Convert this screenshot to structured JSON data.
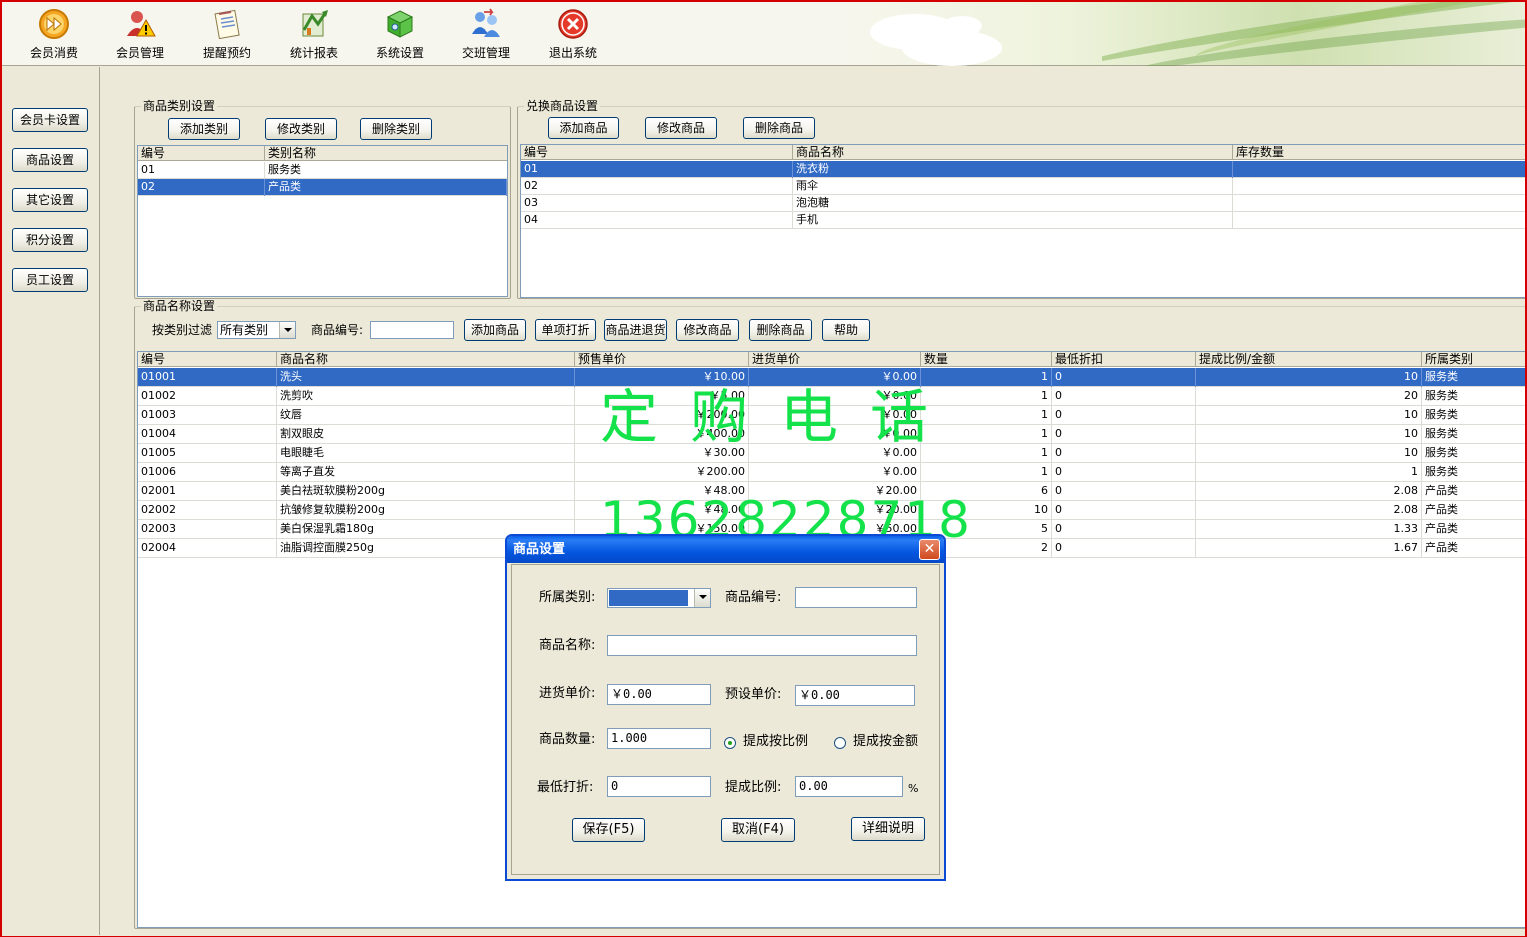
{
  "toolbar": {
    "items": [
      {
        "label": "会员消费",
        "icon": "fast-forward-icon"
      },
      {
        "label": "会员管理",
        "icon": "warning-user-icon"
      },
      {
        "label": "提醒预约",
        "icon": "notepad-icon"
      },
      {
        "label": "统计报表",
        "icon": "chart-report-icon"
      },
      {
        "label": "系统设置",
        "icon": "cube-settings-icon"
      },
      {
        "label": "交班管理",
        "icon": "shift-transfer-icon"
      },
      {
        "label": "退出系统",
        "icon": "exit-icon"
      }
    ]
  },
  "sidebar": {
    "items": [
      "会员卡设置",
      "商品设置",
      "其它设置",
      "积分设置",
      "员工设置"
    ]
  },
  "category_group": {
    "title": "商品类别设置",
    "buttons": [
      "添加类别",
      "修改类别",
      "删除类别"
    ],
    "columns": [
      "编号",
      "类别名称"
    ],
    "rows": [
      [
        "01",
        "服务类"
      ],
      [
        "02",
        "产品类"
      ]
    ],
    "selected_row": 1
  },
  "exchange_group": {
    "title": "兑换商品设置",
    "buttons": [
      "添加商品",
      "修改商品",
      "删除商品"
    ],
    "columns": [
      "编号",
      "商品名称",
      "库存数量"
    ],
    "rows": [
      [
        "01",
        "洗衣粉",
        ""
      ],
      [
        "02",
        "雨伞",
        ""
      ],
      [
        "03",
        "泡泡糖",
        ""
      ],
      [
        "04",
        "手机",
        ""
      ]
    ],
    "selected_row": 0
  },
  "product_group": {
    "title": "商品名称设置",
    "filter_label": "按类别过滤",
    "filter_value": "所有类别",
    "code_label": "商品编号:",
    "code_value": "",
    "buttons": [
      "添加商品",
      "单项打折",
      "商品进退货",
      "修改商品",
      "删除商品",
      "帮助"
    ],
    "columns": [
      "编号",
      "商品名称",
      "预售单价",
      "进货单价",
      "数量",
      "最低折扣",
      "提成比例/金额",
      "所属类别"
    ],
    "rows": [
      [
        "01001",
        "洗头",
        "￥10.00",
        "￥0.00",
        "1",
        "0",
        "10",
        "服务类"
      ],
      [
        "01002",
        "洗剪吹",
        "￥5.00",
        "￥0.00",
        "1",
        "0",
        "20",
        "服务类"
      ],
      [
        "01003",
        "纹唇",
        "￥200.00",
        "￥0.00",
        "1",
        "0",
        "10",
        "服务类"
      ],
      [
        "01004",
        "割双眼皮",
        "￥400.00",
        "￥0.00",
        "1",
        "0",
        "10",
        "服务类"
      ],
      [
        "01005",
        "电眼睫毛",
        "￥30.00",
        "￥0.00",
        "1",
        "0",
        "10",
        "服务类"
      ],
      [
        "01006",
        "等离子直发",
        "￥200.00",
        "￥0.00",
        "1",
        "0",
        "1",
        "服务类"
      ],
      [
        "02001",
        "美白祛斑软膜粉200g",
        "￥48.00",
        "￥20.00",
        "6",
        "0",
        "2.08",
        "产品类"
      ],
      [
        "02002",
        "抗皱修复软膜粉200g",
        "￥48.00",
        "￥20.00",
        "10",
        "0",
        "2.08",
        "产品类"
      ],
      [
        "02003",
        "美白保湿乳霜180g",
        "￥150.00",
        "￥50.00",
        "5",
        "0",
        "1.33",
        "产品类"
      ],
      [
        "02004",
        "油脂调控面膜250g",
        "",
        "",
        "2",
        "0",
        "1.67",
        "产品类"
      ]
    ],
    "selected_row": 0
  },
  "watermark": {
    "line1": "定购电话",
    "line2": "13628228718"
  },
  "dialog": {
    "title": "商品设置",
    "close_label": "✕",
    "category_label": "所属类别:",
    "category_value": "",
    "code_label": "商品编号:",
    "code_value": "",
    "name_label": "商品名称:",
    "name_value": "",
    "cost_label": "进货单价:",
    "cost_value": "￥0.00",
    "preset_label": "预设单价:",
    "preset_value": "￥0.00",
    "qty_label": "商品数量:",
    "qty_value": "1.000",
    "radio_ratio_label": "提成按比例",
    "radio_amount_label": "提成按金额",
    "radio_ratio_selected": true,
    "discount_label": "最低打折:",
    "discount_value": "0",
    "commission_label": "提成比例:",
    "commission_value": "0.00",
    "percent_sign": "%",
    "save_label": "保存(F5)",
    "cancel_label": "取消(F4)",
    "detail_label": "详细说明"
  }
}
